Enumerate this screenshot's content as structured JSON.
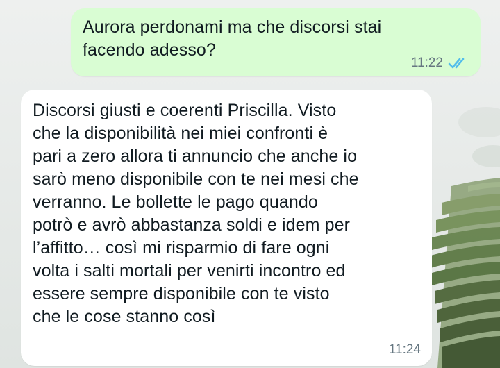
{
  "chat": {
    "messages": [
      {
        "direction": "outgoing",
        "text": "Aurora perdonami ma che discorsi stai\nfacendo adesso?",
        "time": "11:22",
        "status_icon": "double-check-read-icon"
      },
      {
        "direction": "incoming",
        "text": "Discorsi giusti e coerenti Priscilla. Visto\nche la disponibilità nei miei confronti è\npari a zero allora ti annuncio che anche io\nsarò meno disponibile con te nei mesi che\nverranno. Le bollette le pago quando\npotrò e avrò abbastanza soldi e idem per\nl’affitto… così mi risparmio di fare ogni\nvolta i salti mortali per venirti incontro ed\nessere sempre disponibile con te visto\nche le cose stanno così",
        "time": "11:24"
      }
    ]
  },
  "colors": {
    "outgoing_bubble": "#d9fdd3",
    "incoming_bubble": "#ffffff",
    "read_ticks": "#53bdeb",
    "timestamp": "#667781"
  }
}
